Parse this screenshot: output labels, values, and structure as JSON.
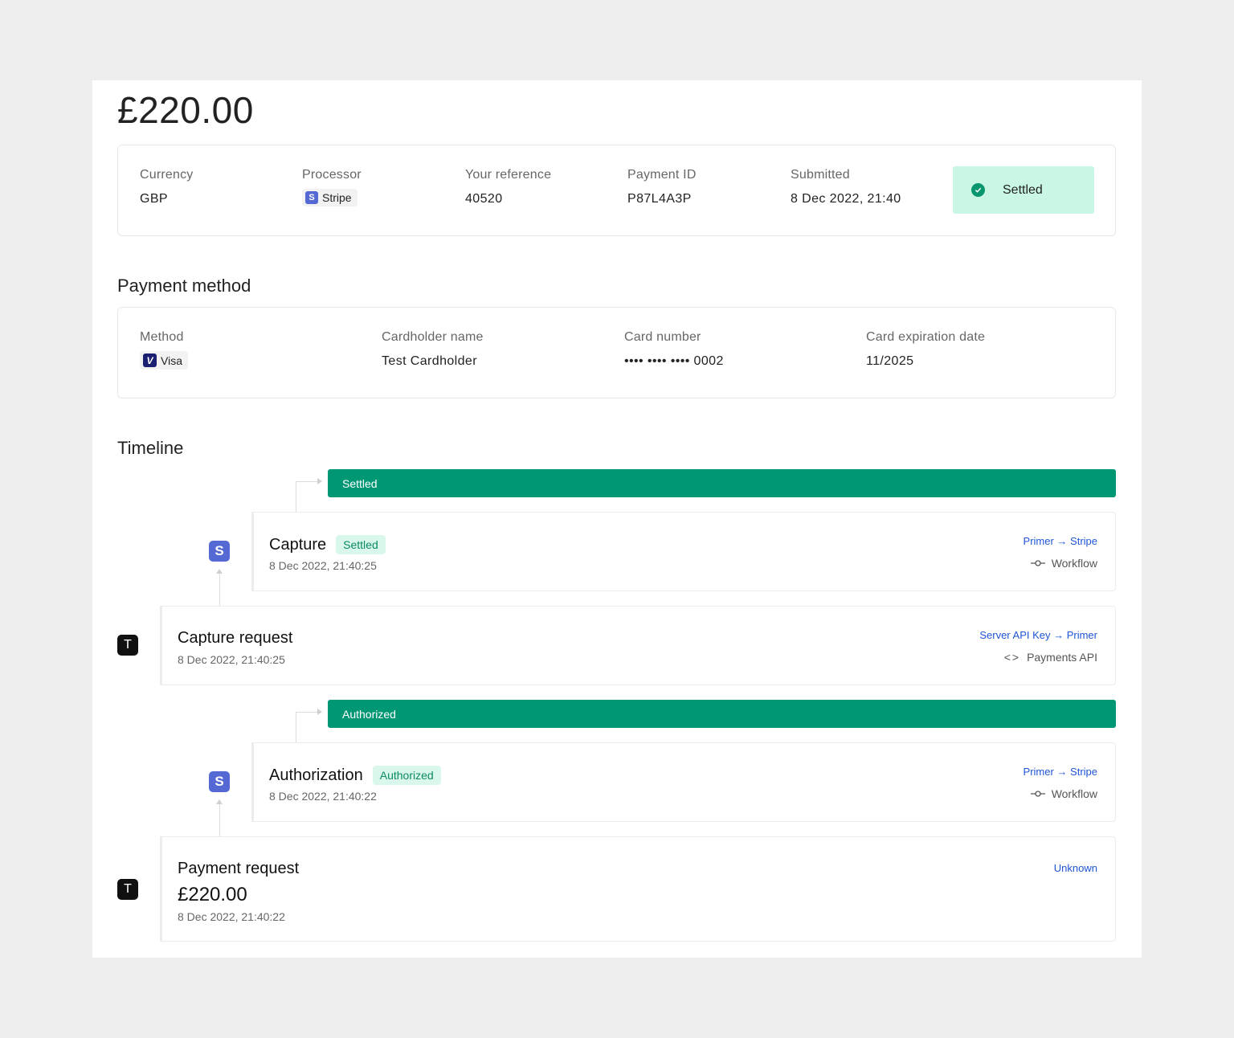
{
  "payment": {
    "amount": "£220.00"
  },
  "summary": {
    "currency": {
      "label": "Currency",
      "value": "GBP"
    },
    "processor": {
      "label": "Processor",
      "value": "Stripe",
      "icon": "stripe-logo-icon"
    },
    "reference": {
      "label": "Your reference",
      "value": "40520"
    },
    "payment_id": {
      "label": "Payment ID",
      "value": "P87L4A3P"
    },
    "submitted": {
      "label": "Submitted",
      "value": "8 Dec 2022, 21:40"
    },
    "status": {
      "label": "Settled",
      "color": "#c9f7e3",
      "icon": "check-circle-icon"
    }
  },
  "payment_method": {
    "title": "Payment method",
    "method": {
      "label": "Method",
      "value": "Visa",
      "icon": "visa-logo-icon"
    },
    "cardholder": {
      "label": "Cardholder name",
      "value": "Test Cardholder"
    },
    "card_number": {
      "label": "Card number",
      "value": "•••• •••• •••• 0002"
    },
    "expiry": {
      "label": "Card expiration date",
      "value": "11/2025"
    }
  },
  "timeline": {
    "title": "Timeline",
    "banners": {
      "settled": "Settled",
      "authorized": "Authorized"
    },
    "accent": "#009775",
    "events": {
      "capture": {
        "title": "Capture",
        "badge": "Settled",
        "date": "8 Dec 2022, 21:40:25",
        "route": "Primer → Stripe",
        "source": "Workflow"
      },
      "capture_request": {
        "title": "Capture request",
        "date": "8 Dec 2022, 21:40:25",
        "route": "Server API Key → Primer",
        "source": "Payments API"
      },
      "authorization": {
        "title": "Authorization",
        "badge": "Authorized",
        "date": "8 Dec 2022, 21:40:22",
        "route": "Primer → Stripe",
        "source": "Workflow"
      },
      "payment_request": {
        "title": "Payment request",
        "amount": "£220.00",
        "date": "8 Dec 2022, 21:40:22",
        "route": "Unknown"
      }
    },
    "icons": {
      "stripe": "S",
      "token": "T"
    }
  }
}
